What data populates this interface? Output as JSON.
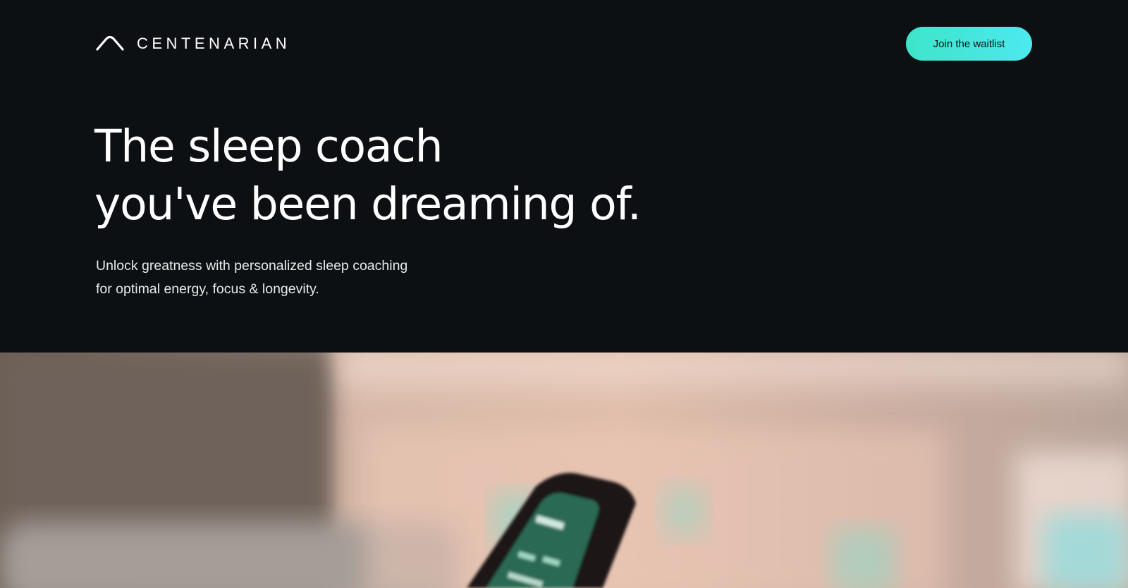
{
  "header": {
    "logo_icon": "centenarian-arch-logo",
    "logo_text": "CENTENARIAN",
    "cta_label": "Join the waitlist"
  },
  "hero": {
    "title_line_1": "The sleep coach",
    "title_line_2": "you've been dreaming of.",
    "subtitle_line_1": "Unlock greatness with personalized sleep coaching",
    "subtitle_line_2": "for optimal energy, focus & longevity."
  },
  "media": {
    "description_icon": "hero-phone-photo"
  },
  "colors": {
    "background": "#0c1013",
    "accent_start": "#3ee5c9",
    "accent_end": "#4de8ef",
    "text": "#ffffff"
  }
}
